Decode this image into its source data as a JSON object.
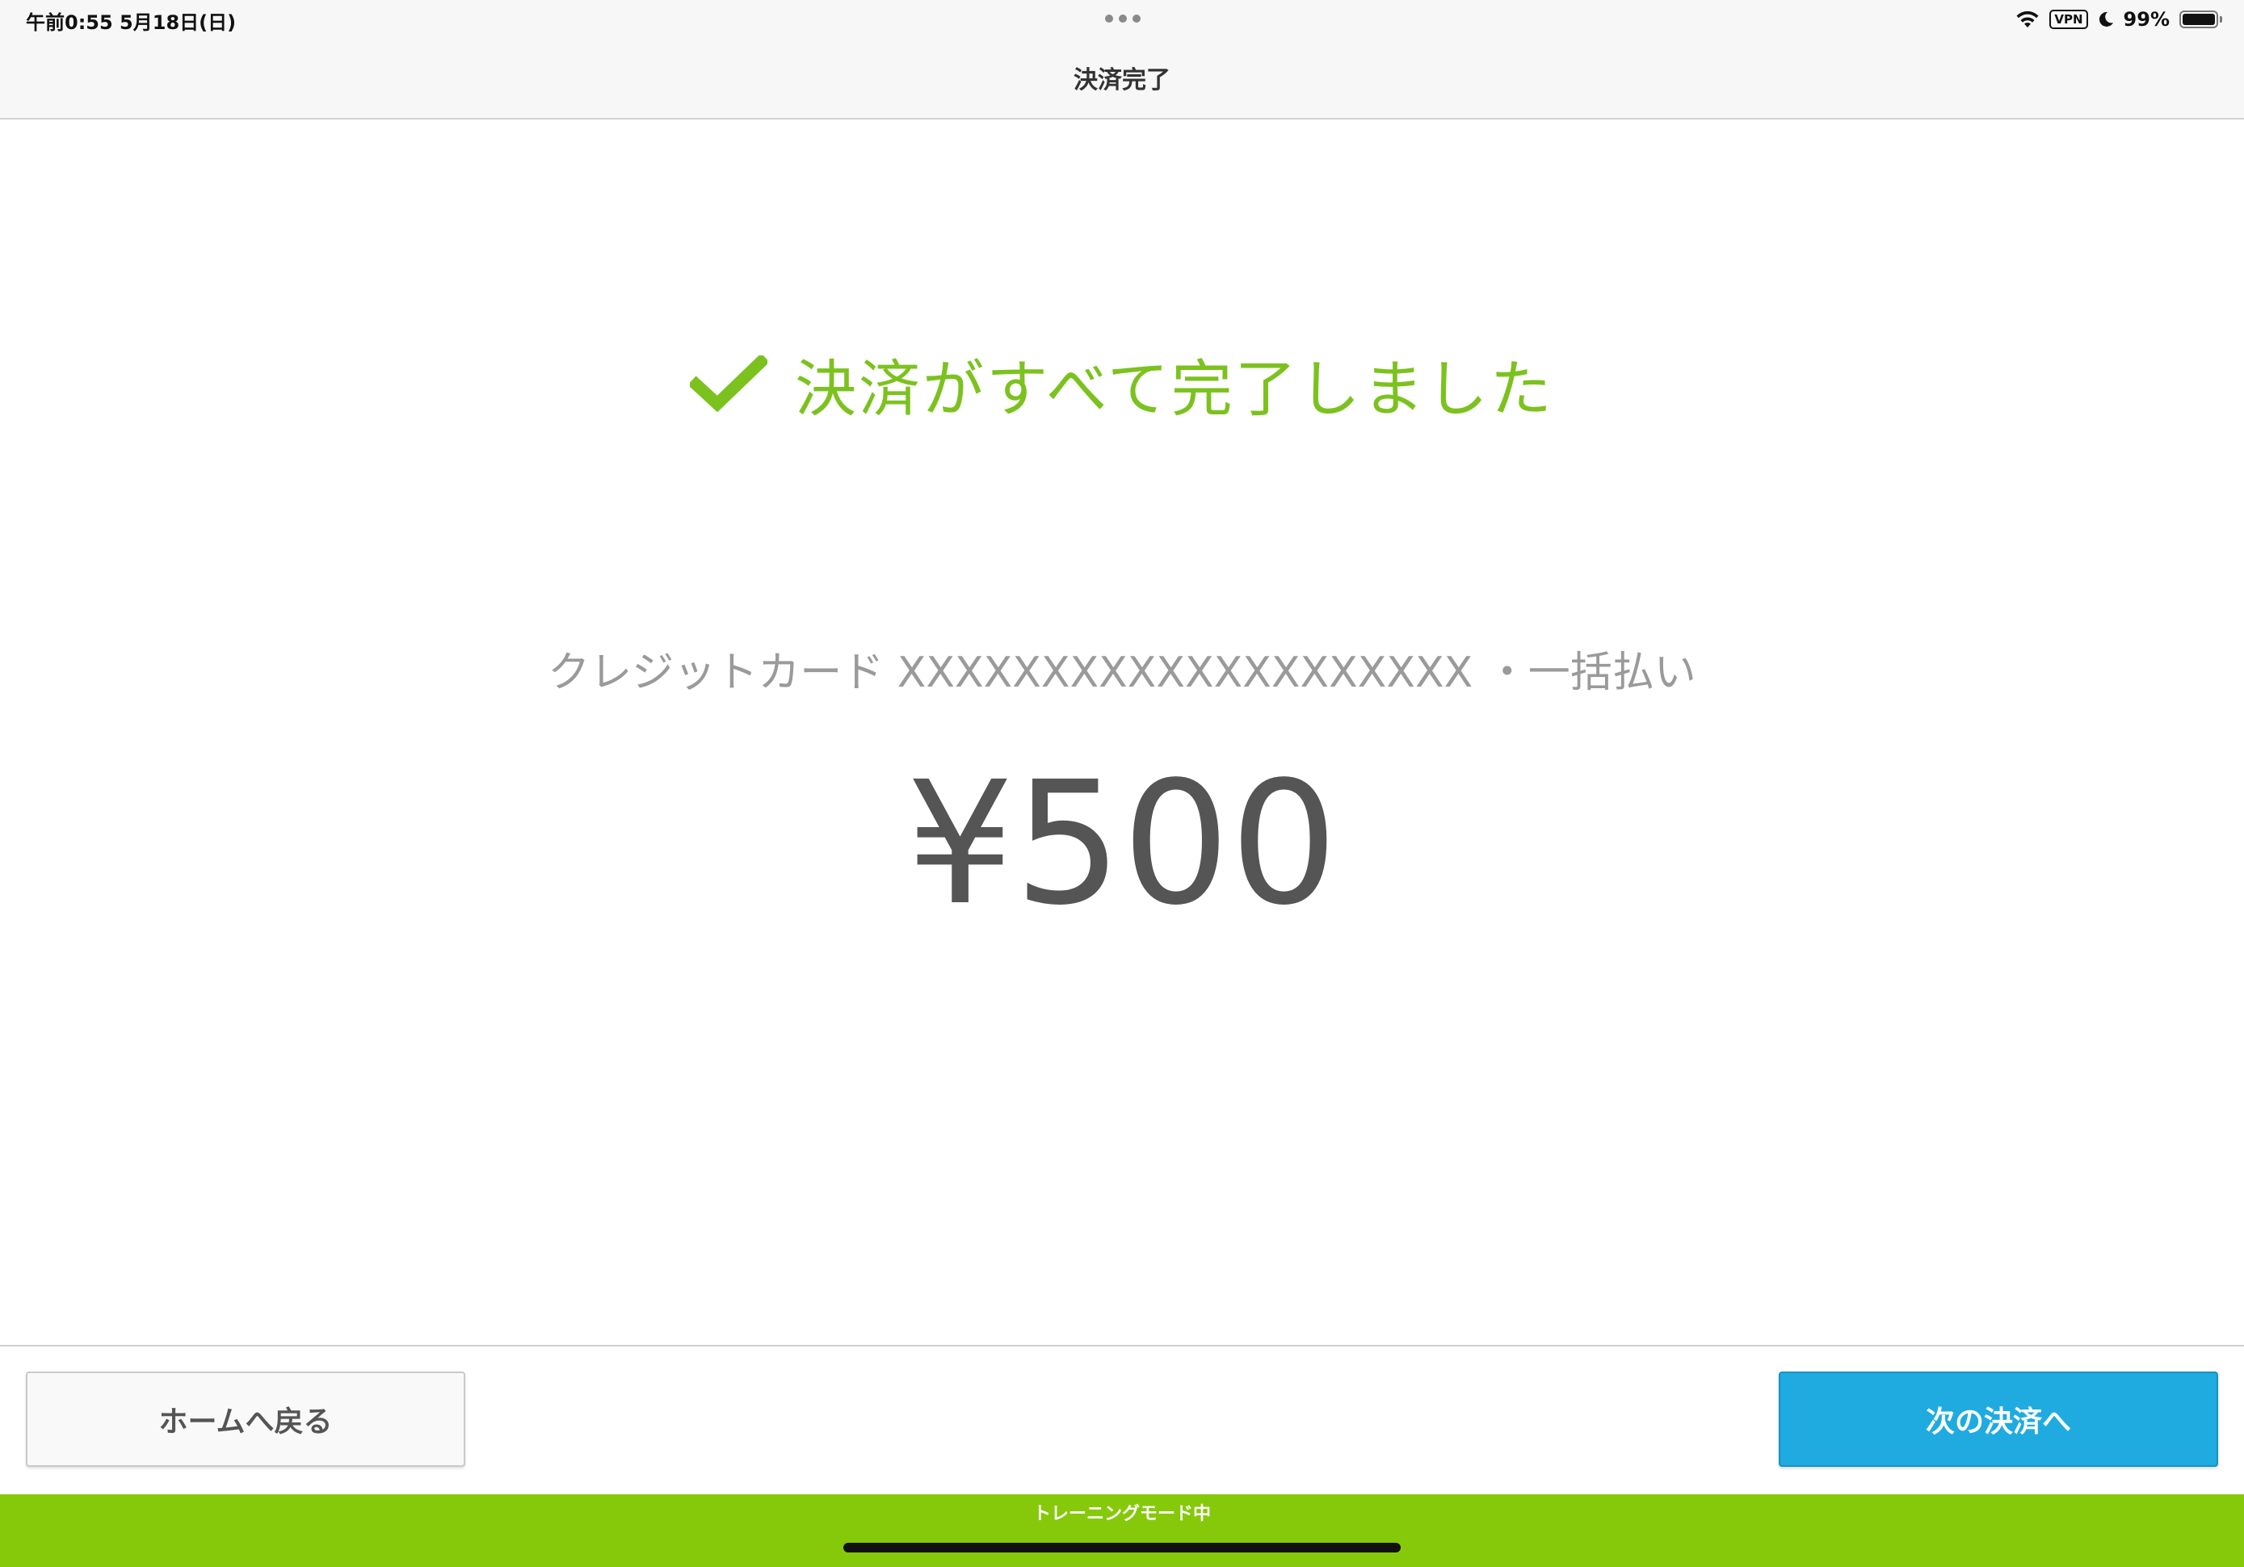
{
  "status_bar": {
    "time_date": "午前0:55   5月18日(日)",
    "vpn": "VPN",
    "battery": "99%",
    "icons": [
      "wifi-icon",
      "vpn-icon",
      "moon-icon",
      "battery-icon"
    ]
  },
  "nav": {
    "title": "決済完了"
  },
  "main": {
    "success_message": "決済がすべて完了しました",
    "payment_method": "クレジットカード XXXXXXXXXXXXXXXXXXXX ・一括払い",
    "amount": "¥500"
  },
  "actions": {
    "home_label": "ホームへ戻る",
    "next_label": "次の決済へ"
  },
  "footer": {
    "training_mode": "トレーニングモード中"
  },
  "colors": {
    "success_green": "#7cc21f",
    "primary_blue": "#1fabe0",
    "training_green": "#86c90b",
    "amount_gray": "#555555"
  }
}
